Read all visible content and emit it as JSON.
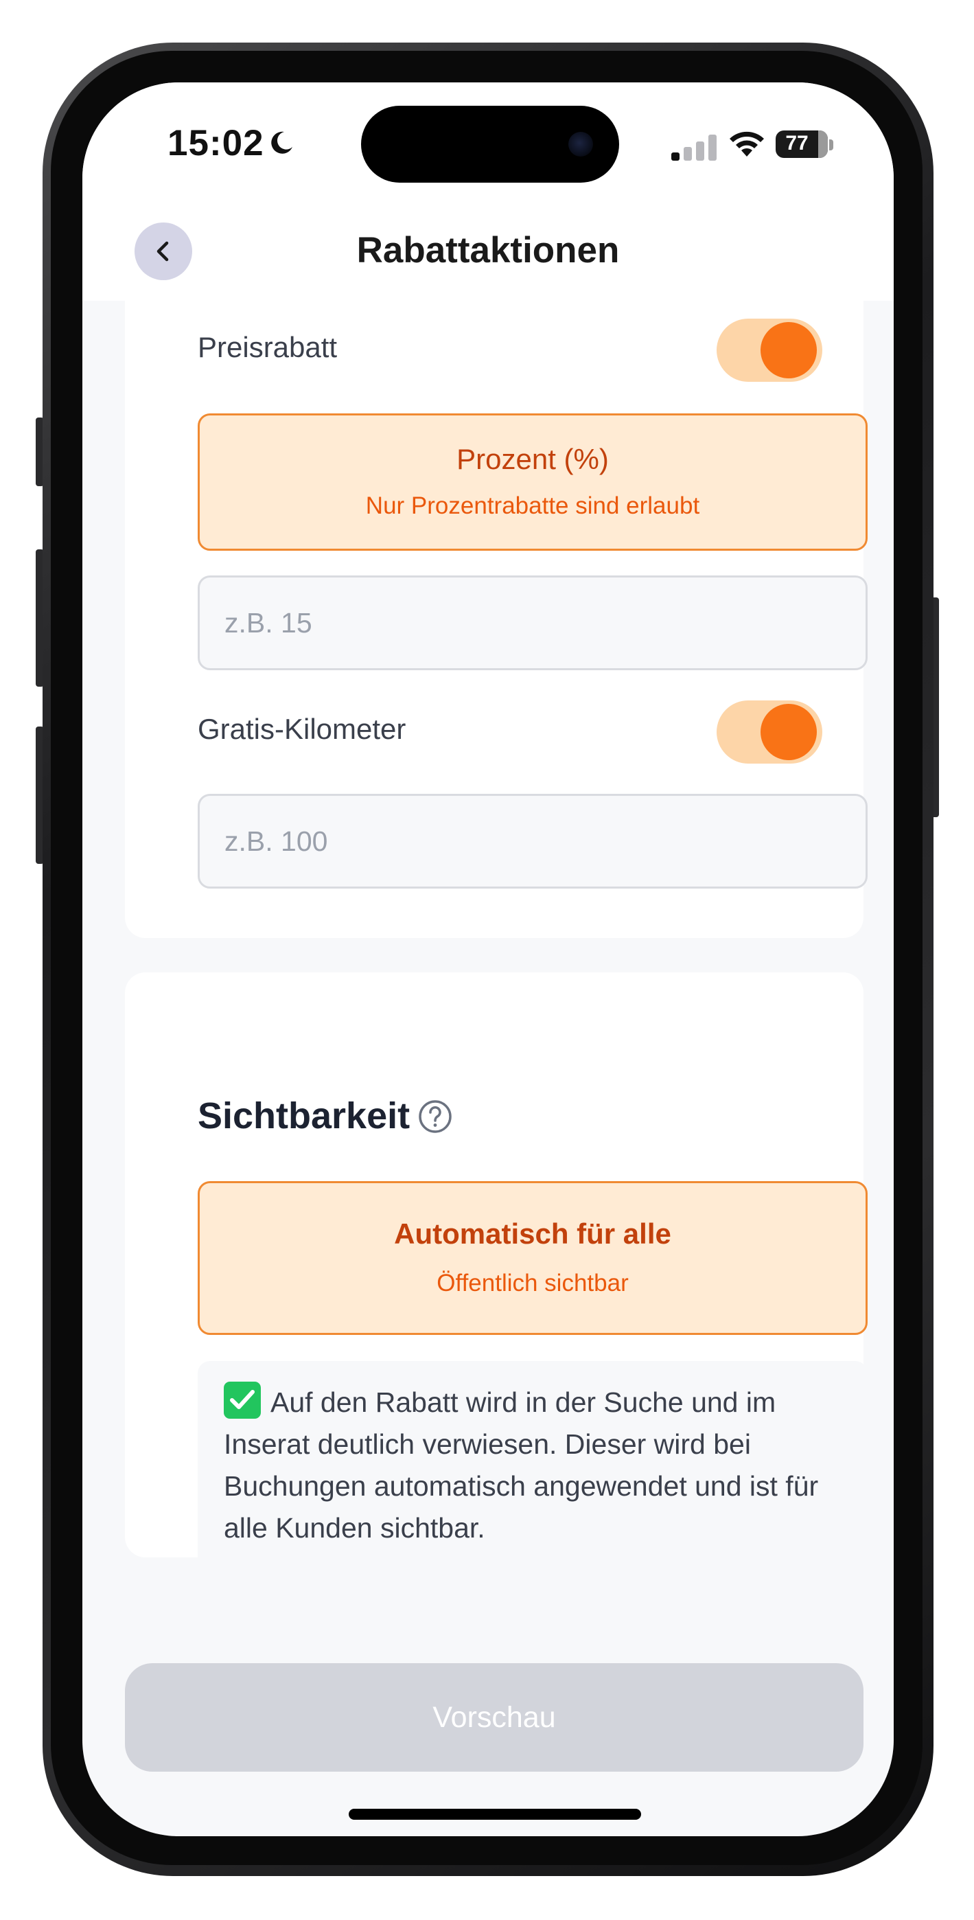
{
  "status_bar": {
    "time": "15:02",
    "battery": "77",
    "icons": [
      "moon-icon",
      "signal-icon",
      "wifi-icon",
      "battery-icon"
    ]
  },
  "header": {
    "title": "Rabattaktionen",
    "back_icon": "chevron-left-icon"
  },
  "price_discount": {
    "label": "Preisrabatt",
    "enabled": true,
    "option_title": "Prozent (%)",
    "option_subtitle": "Nur Prozentrabatte sind erlaubt",
    "input_placeholder": "z.B. 15",
    "input_value": ""
  },
  "free_km": {
    "label": "Gratis-Kilometer",
    "enabled": true,
    "input_placeholder": "z.B. 100",
    "input_value": ""
  },
  "visibility": {
    "title": "Sichtbarkeit",
    "help_icon": "question-circle-icon",
    "option_title": "Automatisch für alle",
    "option_subtitle": "Öffentlich sichtbar",
    "info_text": "Auf den Rabatt wird in der Suche und im Inserat deutlich verwiesen. Dieser wird bei Buchungen automatisch angewendet und ist für alle Kunden sichtbar."
  },
  "preview_button": {
    "label": "Vorschau"
  },
  "colors": {
    "accent": "#f97316",
    "accent_light": "#ffebd4",
    "toggle_track": "#fdd5a8",
    "text_dark": "#1c2231",
    "button_disabled": "#d2d4db"
  }
}
